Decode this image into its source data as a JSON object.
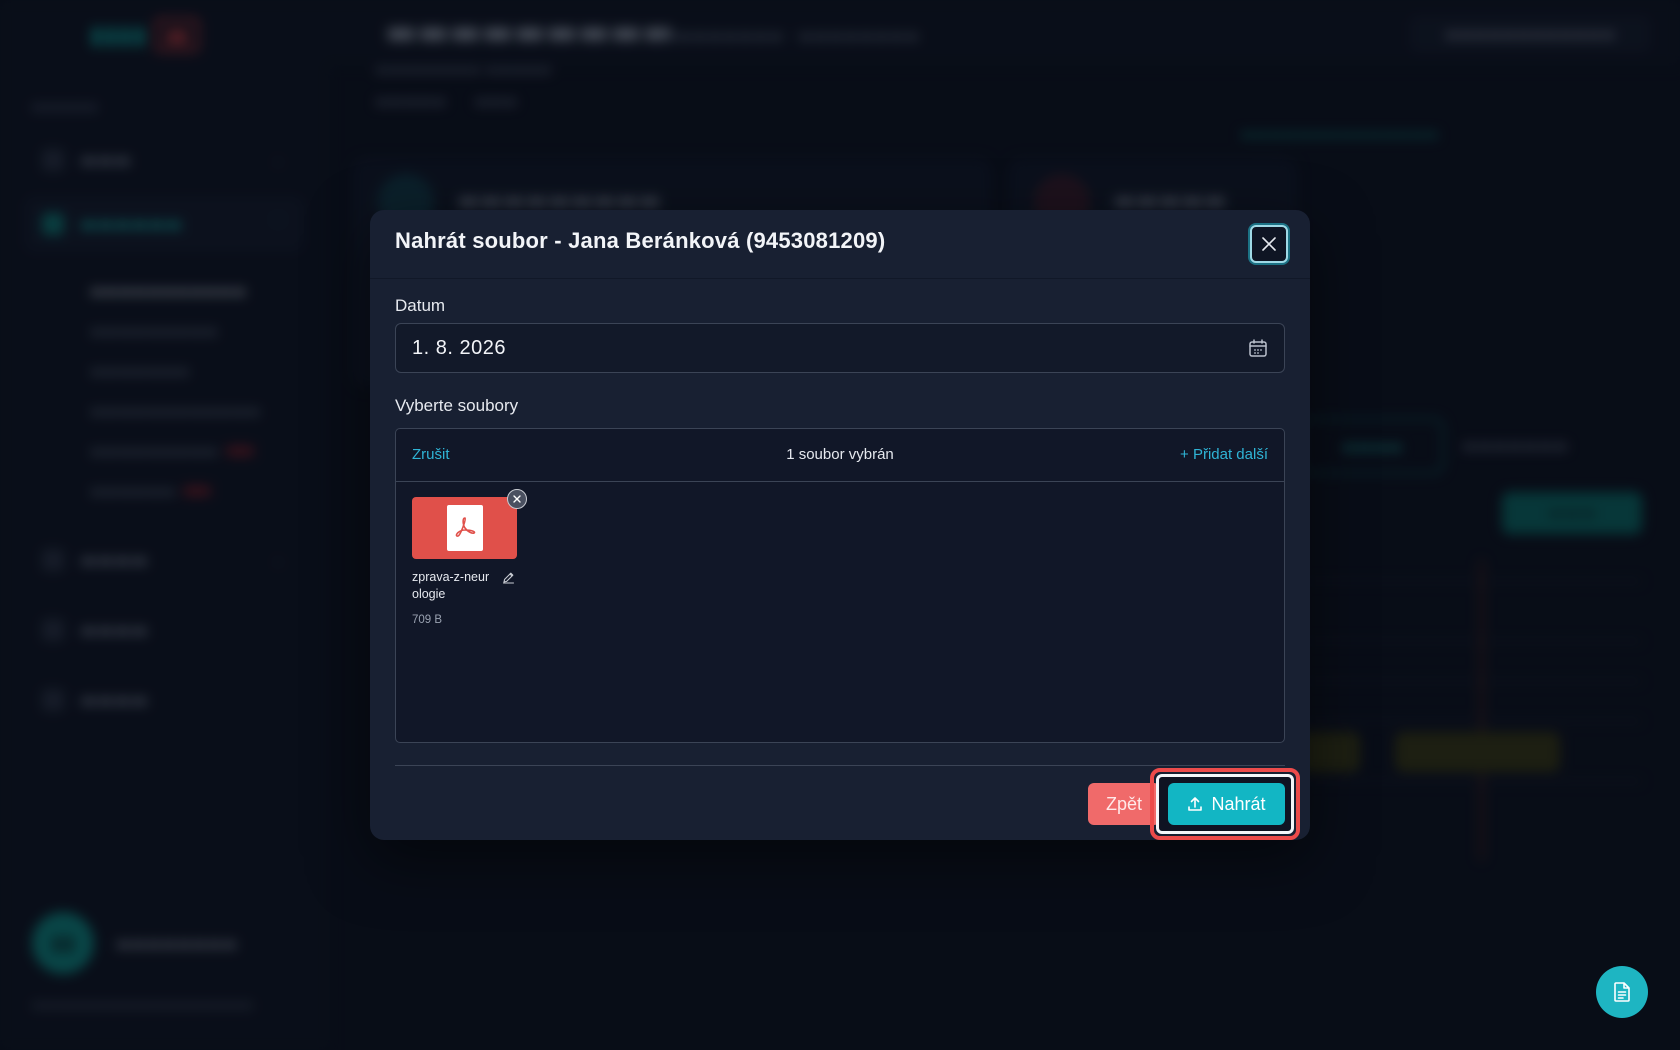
{
  "modal": {
    "title": "Nahrát soubor - Jana Beránková (9453081209)",
    "date_label": "Datum",
    "date_value": "1. 8. 2026",
    "files_label": "Vyberte soubory",
    "cancel_label": "Zrušit",
    "selected_count": "1 soubor vybrán",
    "add_more_label": "+ Přidat další",
    "file": {
      "name": "zprava-z-neurologie",
      "size": "709 B",
      "type": "pdf"
    },
    "back_label": "Zpět",
    "upload_label": "Nahrát"
  },
  "icons": {
    "close": "close-icon",
    "calendar": "calendar-icon",
    "pdf": "pdf-icon",
    "remove": "remove-file-icon",
    "edit": "pencil-icon",
    "upload": "upload-icon",
    "fab": "document-icon"
  },
  "colors": {
    "accent": "#12b6c4",
    "link": "#2fb4d6",
    "danger": "#f06a6a",
    "pdf": "#e0504a",
    "modal_bg": "#182032",
    "highlight_ring": "#ec4b4b"
  }
}
